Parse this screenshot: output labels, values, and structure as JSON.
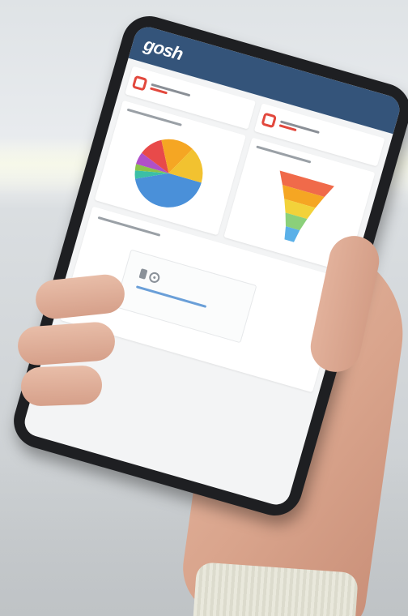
{
  "app": {
    "logo_text": "gosh",
    "header_color": "#34547a"
  },
  "stats": [
    {
      "icon": "calendar-icon",
      "color": "#e2483d"
    },
    {
      "icon": "calendar-icon",
      "color": "#e2483d"
    }
  ],
  "charts": [
    {
      "type": "pie",
      "colors": [
        "#4a90d9",
        "#3bbfa6",
        "#8bc34a",
        "#b050c8",
        "#e84a4a",
        "#f5a623",
        "#f2c230"
      ]
    },
    {
      "type": "funnel",
      "colors": [
        "#f06a4a",
        "#f5a623",
        "#f2d23a",
        "#8bd07a",
        "#5ab0e8"
      ]
    }
  ],
  "activities": {
    "empty_icons": [
      "document-icon",
      "gear-icon"
    ]
  }
}
